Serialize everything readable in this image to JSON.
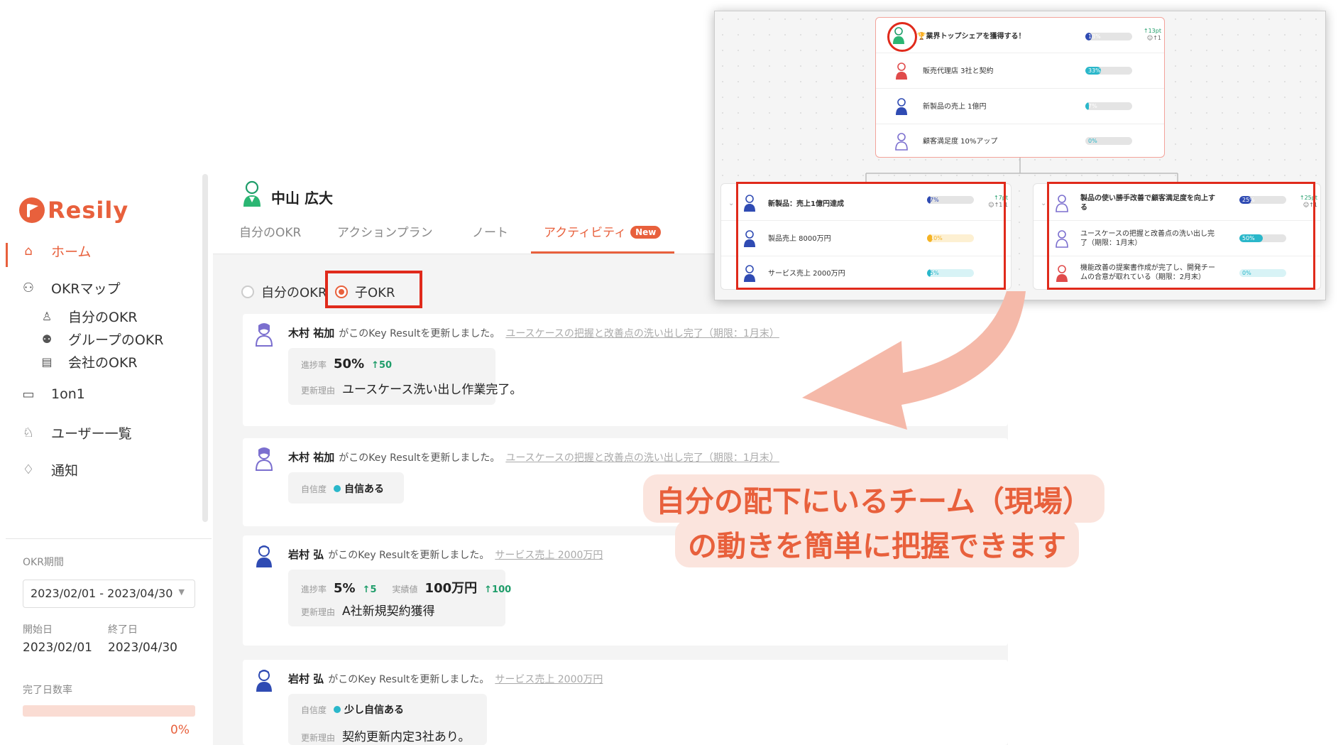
{
  "app": {
    "name": "Resily"
  },
  "sidebar": {
    "nav": [
      {
        "label": "ホーム",
        "icon": "home-icon"
      },
      {
        "label": "OKRマップ",
        "icon": "map-icon"
      },
      {
        "label": "1on1",
        "icon": "chat-icon"
      },
      {
        "label": "ユーザー一覧",
        "icon": "users-icon"
      },
      {
        "label": "通知",
        "icon": "bell-icon"
      }
    ],
    "okr_sub": [
      {
        "label": "自分のOKR",
        "icon": "person-icon"
      },
      {
        "label": "グループのOKR",
        "icon": "group-icon"
      },
      {
        "label": "会社のOKR",
        "icon": "building-icon"
      }
    ],
    "period_label": "OKR期間",
    "period_value": "2023/02/01 - 2023/04/30",
    "start_label": "開始日",
    "start_value": "2023/02/01",
    "end_label": "終了日",
    "end_value": "2023/04/30",
    "done_label": "完了日数率",
    "done_value": "0%"
  },
  "header": {
    "user_name": "中山 広大",
    "tabs": [
      "自分のOKR",
      "アクションプラン",
      "ノート",
      "アクティビティ"
    ],
    "new_badge": "New"
  },
  "filter": {
    "option_mine": "自分のOKR",
    "option_child": "子OKR",
    "selected": "子OKR"
  },
  "activities": [
    {
      "user": "木村 祐加",
      "action": "がこのKey Resultを更新しました。",
      "target": "ユースケースの把握と改善点の洗い出し完了（期限：1月末）",
      "k1": "進捗率",
      "v1": "50%",
      "d1": "↑50",
      "reason_label": "更新理由",
      "reason": "ユースケース洗い出し作業完了。"
    },
    {
      "user": "木村 祐加",
      "action": "がこのKey Resultを更新しました。",
      "target": "ユースケースの把握と改善点の洗い出し完了（期限：1月末）",
      "k1": "自信度",
      "v1": "自信ある"
    },
    {
      "user": "岩村 弘",
      "action": "がこのKey Resultを更新しました。",
      "target": "サービス売上 2000万円",
      "k1": "進捗率",
      "v1": "5%",
      "d1": "↑5",
      "k2": "実績値",
      "v2": "100万円",
      "d2": "↑100",
      "reason_label": "更新理由",
      "reason": "A社新規契約獲得"
    },
    {
      "user": "岩村 弘",
      "action": "がこのKey Resultを更新しました。",
      "target": "サービス売上 2000万円",
      "k1": "自信度",
      "v1": "少し自信ある",
      "reason_label": "更新理由",
      "reason": "契約更新内定3社あり。"
    }
  ],
  "map": {
    "top": {
      "objective": "🏆業界トップシェアを獲得する！",
      "objective_pct": "13%",
      "objective_progress": 13,
      "objective_delta": "↑13pt",
      "objective_delta2": "☺↑1",
      "krs": [
        {
          "text": "販売代理店 3社と契約",
          "pct": "33%",
          "progress": 33,
          "color": "#2ab7ca"
        },
        {
          "text": "新製品の売上 1億円",
          "pct": "7%",
          "progress": 7,
          "color": "#2ab7ca"
        },
        {
          "text": "顧客満足度 10%アップ",
          "pct": "0%",
          "progress": 0,
          "color": "#2ab7ca"
        }
      ]
    },
    "left": {
      "objective": "新製品：売上1億円達成",
      "objective_pct": "7%",
      "objective_progress": 7,
      "objective_delta": "↑7pt",
      "objective_delta2": "☺↑1 1",
      "krs": [
        {
          "text": "製品売上 8000万円",
          "pct": "10%",
          "progress": 10,
          "color": "#f5b324"
        },
        {
          "text": "サービス売上 2000万円",
          "pct": "5%",
          "progress": 5,
          "color": "#2ab7ca"
        }
      ]
    },
    "right": {
      "objective_line1": "製品の使い勝手改善で顧客満足度を向上す",
      "objective_line2": "る",
      "objective_pct": "25%",
      "objective_progress": 25,
      "objective_delta": "↑25pt",
      "objective_delta2": "☺↑1",
      "krs": [
        {
          "line1": "ユースケースの把握と改善点の洗い出し完",
          "line2": "了（期限：1月末）",
          "pct": "50%",
          "progress": 50,
          "color": "#2ab7ca"
        },
        {
          "line1": "機能改善の提案書作成が完了し、開発チー",
          "line2": "ムの合意が取れている（期限：2月末）",
          "pct": "0%",
          "progress": 0,
          "color": "#2ab7ca"
        }
      ]
    }
  },
  "annotation": {
    "line1": "自分の配下にいるチーム（現場）",
    "line2": "の動きを簡単に把握できます"
  },
  "colors": {
    "brand": "#e8603c",
    "highlight": "#e02a1b",
    "bar_blue": "#2f4bb3",
    "bar_teal": "#2ab7ca",
    "bar_yellow": "#f5b324",
    "delta_green": "#1f9d6a"
  }
}
